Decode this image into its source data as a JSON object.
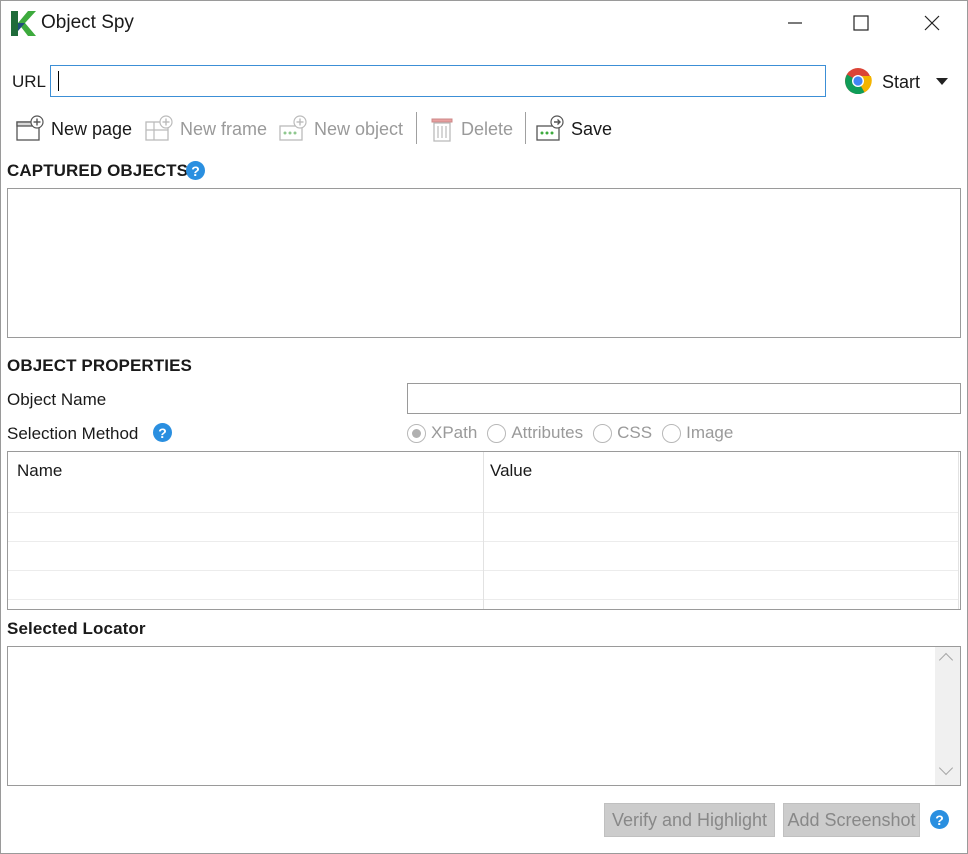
{
  "window": {
    "title": "Object Spy",
    "controls": [
      "minimize",
      "maximize",
      "close"
    ]
  },
  "url_bar": {
    "label": "URL",
    "value": "",
    "browser_icon": "chrome-icon",
    "start_label": "Start"
  },
  "toolbar": {
    "new_page": "New page",
    "new_frame": "New frame",
    "new_object": "New object",
    "delete": "Delete",
    "save": "Save"
  },
  "captured_objects": {
    "heading": "CAPTURED OBJECTS"
  },
  "object_properties": {
    "heading": "OBJECT PROPERTIES",
    "object_name_label": "Object Name",
    "object_name_value": "",
    "selection_method_label": "Selection Method",
    "selection_options": [
      {
        "label": "XPath",
        "selected": true
      },
      {
        "label": "Attributes",
        "selected": false
      },
      {
        "label": "CSS",
        "selected": false
      },
      {
        "label": "Image",
        "selected": false
      }
    ],
    "table": {
      "columns": [
        "Name",
        "Value"
      ],
      "rows": []
    }
  },
  "selected_locator": {
    "heading": "Selected Locator",
    "value": ""
  },
  "footer": {
    "verify_highlight": "Verify and Highlight",
    "add_screenshot": "Add Screenshot"
  },
  "colors": {
    "accent": "#3c8fd6",
    "help_icon": "#2a8fe0",
    "disabled_text": "#9a9a9a",
    "logo_green": "#3daa3d",
    "logo_dark": "#1f4e79"
  }
}
